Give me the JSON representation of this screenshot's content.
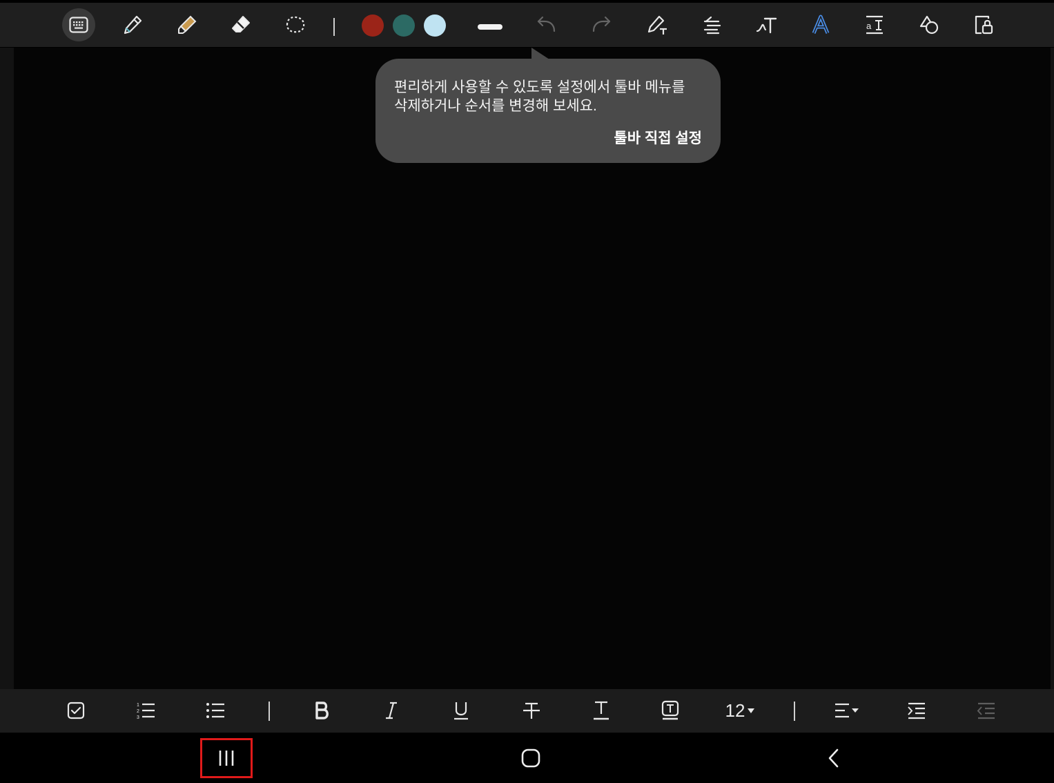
{
  "top_toolbar": {
    "tools": [
      {
        "id": "keyboard",
        "icon": "keyboard-icon",
        "selected": true
      },
      {
        "id": "pen",
        "icon": "pen-icon"
      },
      {
        "id": "highlighter",
        "icon": "highlighter-icon"
      },
      {
        "id": "eraser",
        "icon": "eraser-icon"
      },
      {
        "id": "lasso",
        "icon": "lasso-select-icon"
      }
    ],
    "colors": [
      "#9b2418",
      "#2c6a64",
      "#bfe3f2"
    ],
    "actions": [
      {
        "id": "undo",
        "icon": "undo-icon",
        "enabled": false
      },
      {
        "id": "redo",
        "icon": "redo-icon",
        "enabled": false
      },
      {
        "id": "handwriting-to-text",
        "icon": "pen-to-text-icon"
      },
      {
        "id": "straighten",
        "icon": "straighten-text-icon"
      },
      {
        "id": "shape-text",
        "icon": "handwriting-text-icon"
      },
      {
        "id": "text-style",
        "icon": "text-style-a-icon"
      },
      {
        "id": "text-spacing",
        "icon": "text-spacing-icon"
      },
      {
        "id": "shapes",
        "icon": "shapes-icon"
      },
      {
        "id": "lock",
        "icon": "lock-page-icon"
      }
    ]
  },
  "tooltip": {
    "message": "편리하게 사용할 수 있도록 설정에서 툴바 메뉴를\n삭제하거나 순서를 변경해 보세요.",
    "link_label": "툴바 직접 설정"
  },
  "bottom_toolbar": {
    "buttons": [
      {
        "id": "checkbox",
        "icon": "checkbox-icon"
      },
      {
        "id": "numbered-list",
        "icon": "numbered-list-icon"
      },
      {
        "id": "bullet-list",
        "icon": "bullet-list-icon"
      },
      {
        "id": "bold",
        "icon": "bold-icon"
      },
      {
        "id": "italic",
        "icon": "italic-icon"
      },
      {
        "id": "underline",
        "icon": "underline-icon"
      },
      {
        "id": "strikethrough",
        "icon": "strikethrough-icon"
      },
      {
        "id": "text-color",
        "icon": "text-color-icon"
      },
      {
        "id": "text-background",
        "icon": "text-background-icon"
      },
      {
        "id": "align",
        "icon": "align-icon"
      },
      {
        "id": "indent",
        "icon": "indent-icon"
      },
      {
        "id": "outdent",
        "icon": "outdent-icon",
        "enabled": false
      }
    ],
    "font_size": "12"
  },
  "nav_bar": {
    "buttons": [
      {
        "id": "recent-apps",
        "icon": "recent-apps-icon",
        "highlighted": true
      },
      {
        "id": "home",
        "icon": "home-icon"
      },
      {
        "id": "back",
        "icon": "back-icon"
      }
    ],
    "highlight_color": "#e01a1a"
  }
}
